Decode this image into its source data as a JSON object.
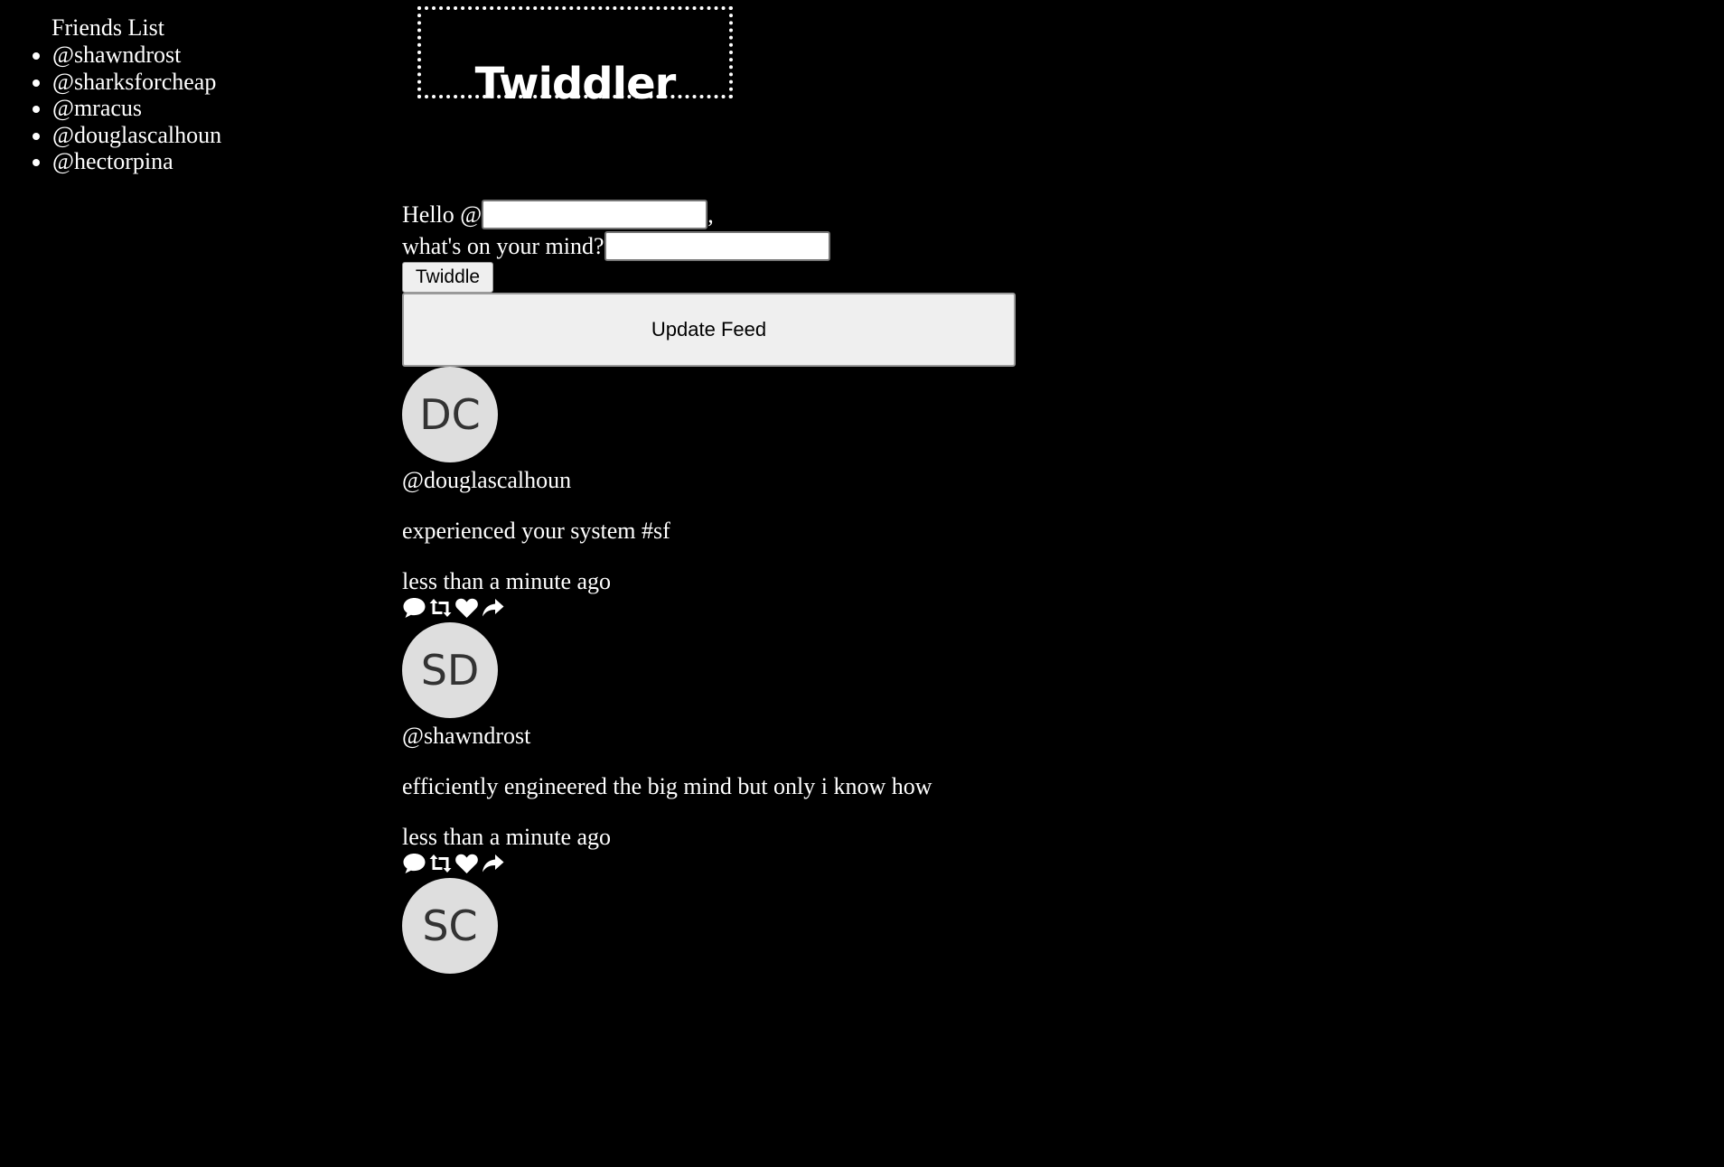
{
  "friends": {
    "title": "Friends List",
    "items": [
      "@shawndrost",
      "@sharksforcheap",
      "@mracus",
      "@douglascalhoun",
      "@hectorpina"
    ]
  },
  "header": {
    "logo": "Twiddler"
  },
  "compose": {
    "hello_label": "Hello @",
    "comma": ",",
    "username_value": "",
    "mind_label": "what's on your mind?",
    "message_value": "",
    "twiddle_label": "Twiddle",
    "update_label": "Update Feed"
  },
  "feed": [
    {
      "initials": "DC",
      "handle": "@douglascalhoun",
      "message": "experienced your system #sf",
      "time": "less than a minute ago"
    },
    {
      "initials": "SD",
      "handle": "@shawndrost",
      "message": "efficiently engineered the big mind but only i know how",
      "time": "less than a minute ago"
    },
    {
      "initials": "SC",
      "handle": "",
      "message": "",
      "time": ""
    }
  ],
  "icons": [
    "comment-icon",
    "retweet-icon",
    "heart-icon",
    "share-icon"
  ]
}
